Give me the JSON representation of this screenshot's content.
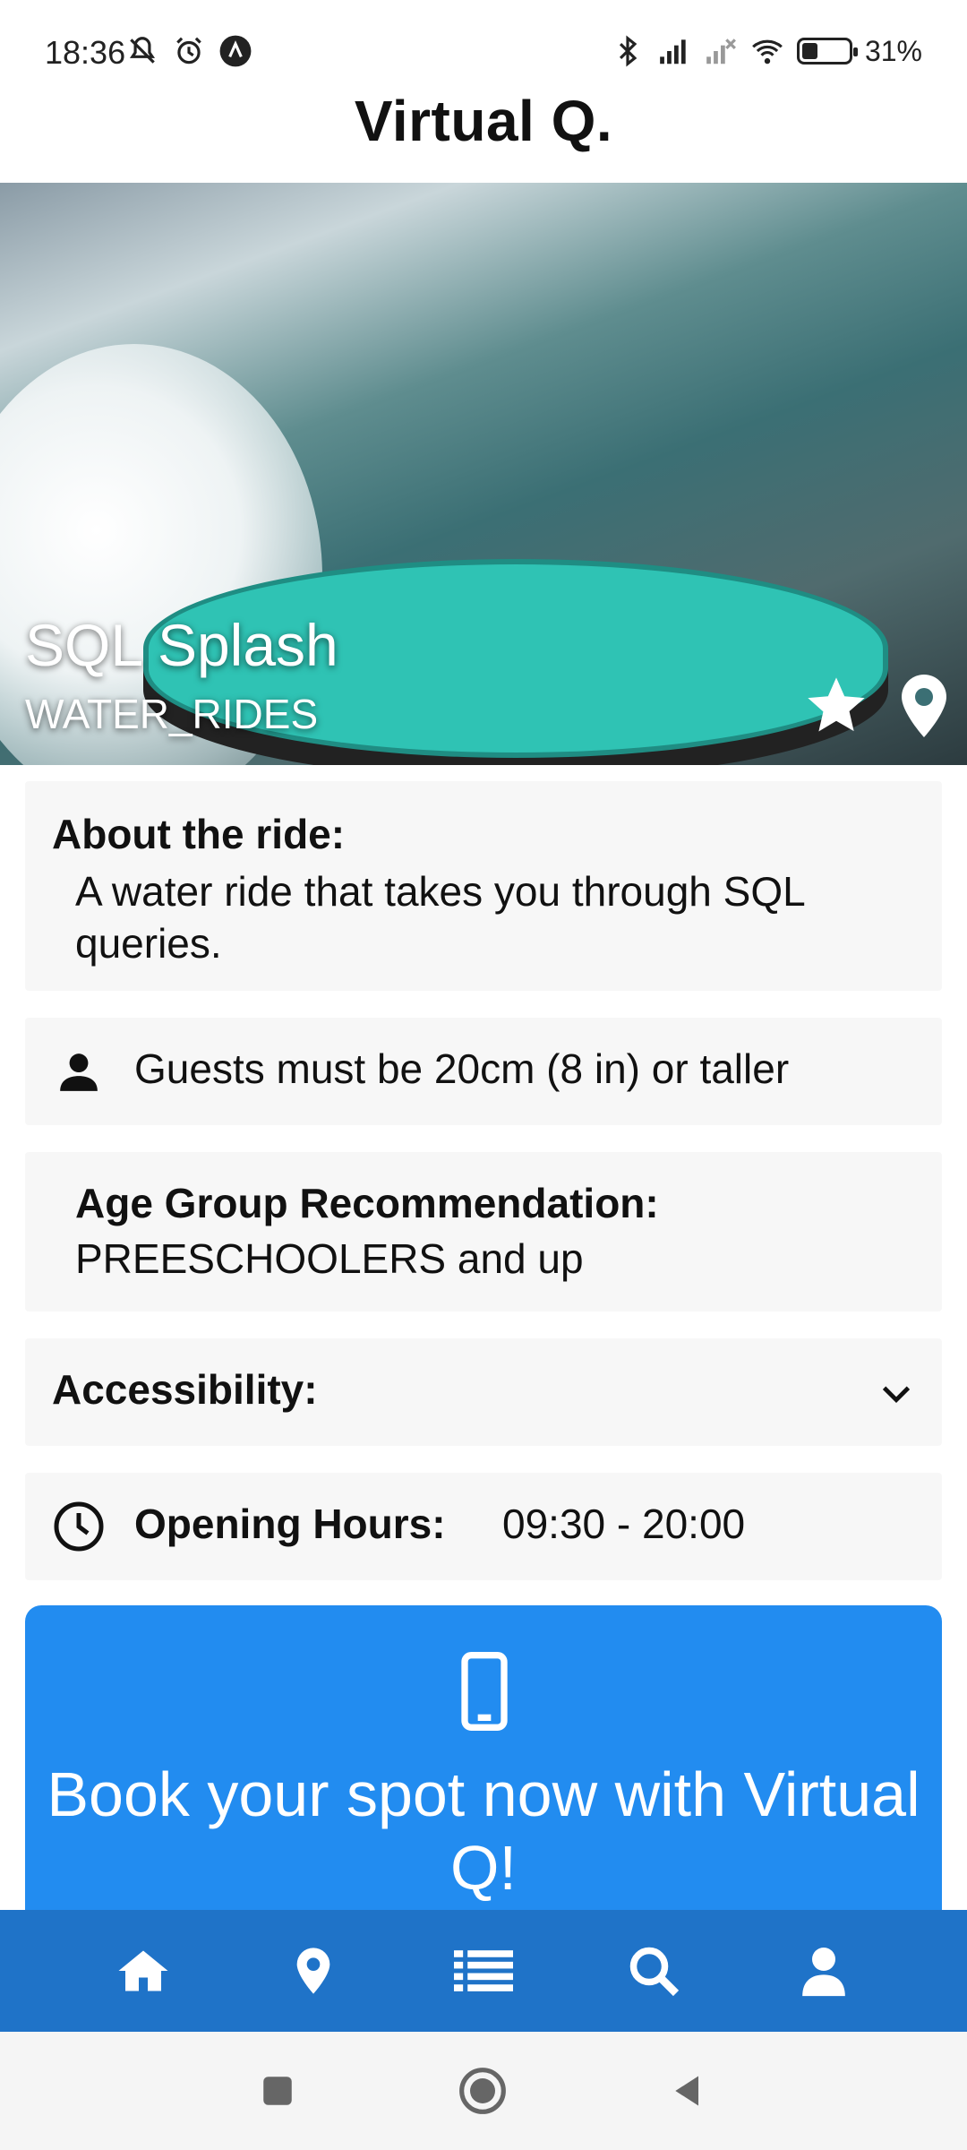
{
  "status_bar": {
    "time": "18:36",
    "battery": "31%",
    "icons_left": [
      "mute-bell-icon",
      "alarm-icon",
      "app-notification-icon"
    ],
    "icons_right": [
      "bluetooth-icon",
      "signal-icon",
      "signal-off-icon",
      "wifi-icon",
      "battery-icon"
    ],
    "battery_level": 0.31
  },
  "app_bar": {
    "title": "Virtual Q."
  },
  "ride": {
    "name": "SQL Splash",
    "category": "WATER_RIDES"
  },
  "about": {
    "label": "About the ride:",
    "text": "A water ride that takes you through SQL queries."
  },
  "height_requirement": {
    "text": "Guests must be 20cm (8 in) or taller",
    "icon": "person-icon"
  },
  "age_group": {
    "label": "Age Group Recommendation:",
    "value": "PREESCHOOLERS and up"
  },
  "accessibility": {
    "label": "Accessibility:",
    "icon": "chevron-down-icon"
  },
  "opening_hours": {
    "label": "Opening Hours:",
    "value": "09:30 - 20:00",
    "icon": "clock-icon"
  },
  "book": {
    "text": "Book your spot now with Virtual Q!",
    "icon": "phone-icon"
  },
  "bottom_nav": {
    "items": [
      "home-icon",
      "location-icon",
      "list-icon",
      "search-icon",
      "user-icon"
    ]
  },
  "system_nav": {
    "items": [
      "recents-button",
      "home-button",
      "back-button"
    ]
  },
  "colors": {
    "primary": "#228cf0",
    "nav_bar": "#1f73c8",
    "card_bg": "#f7f7f7"
  }
}
